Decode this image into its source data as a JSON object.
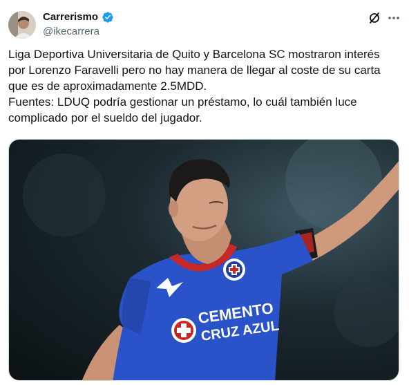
{
  "author": {
    "display_name": "Carrerismo",
    "handle": "@ikecarrera",
    "verified": true
  },
  "post": {
    "lines": [
      "Liga Deportiva Universitaria de Quito y Barcelona SC mostraron interés",
      "por Lorenzo Faravelli pero no hay manera de llegar al coste de su carta",
      "que es de aproximadamente 2.5MDD.",
      "Fuentes: LDUQ podría gestionar un préstamo, lo cuál también luce",
      "complicado por el sueldo del jugador."
    ]
  },
  "media": {
    "jersey_text_line1": "CEMENTO",
    "jersey_text_line2": "CRUZ AZUL"
  },
  "icons": {
    "verified": "verified-badge-icon",
    "grok": "grok-icon",
    "more": "more-options-icon"
  },
  "colors": {
    "verified_blue": "#1d9bf0",
    "jersey_blue": "#2a52c9",
    "text_primary": "#0f1419",
    "text_secondary": "#536471"
  }
}
